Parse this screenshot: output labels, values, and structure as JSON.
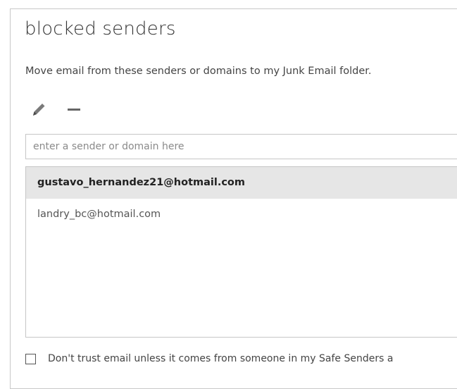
{
  "page": {
    "title": "blocked senders",
    "description": "Move email from these senders or domains to my Junk Email folder."
  },
  "toolbar": {
    "edit_icon": "pencil-icon",
    "remove_icon": "minus-icon"
  },
  "sender_input": {
    "placeholder": "enter a sender or domain here",
    "value": ""
  },
  "senders": [
    {
      "address": "gustavo_hernandez21@hotmail.com",
      "selected": true
    },
    {
      "address": "landry_bc@hotmail.com",
      "selected": false
    }
  ],
  "trust_option": {
    "label": "Don't trust email unless it comes from someone in my Safe Senders a",
    "checked": false
  },
  "colors": {
    "selected_row": "#e6e6e6",
    "border": "#c6c6c6",
    "text": "#333333"
  }
}
